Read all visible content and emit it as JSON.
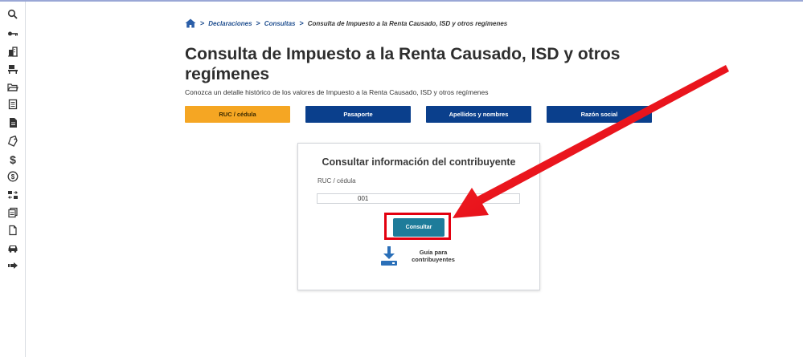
{
  "sidebar": {
    "icons": [
      "search-icon",
      "key-icon",
      "building-icon",
      "desk-icon",
      "folder-open-icon",
      "document-list-icon",
      "document-icon",
      "tag-icon",
      "dollar-icon",
      "dollar-circle-icon",
      "transfer-icon",
      "documents-stack-icon",
      "file-icon",
      "car-icon",
      "arrow-right-icon"
    ]
  },
  "breadcrumb": {
    "items": [
      "Declaraciones",
      "Consultas"
    ],
    "current": "Consulta de Impuesto a la Renta Causado, ISD y otros regímenes"
  },
  "page": {
    "title": "Consulta de Impuesto a la Renta Causado, ISD y otros regímenes",
    "description": "Conozca un detalle histórico de los valores de Impuesto a la Renta Causado, ISD y otros regímenes"
  },
  "tabs": [
    {
      "label": "RUC / cédula",
      "active": true
    },
    {
      "label": "Pasaporte",
      "active": false
    },
    {
      "label": "Apellidos y nombres",
      "active": false
    },
    {
      "label": "Razón social",
      "active": false
    }
  ],
  "card": {
    "title": "Consultar información del contribuyente",
    "field_label": "RUC / cédula",
    "field_value": "001",
    "button_label": "Consultar",
    "guide_label": "Guía para contribuyentes"
  },
  "colors": {
    "primary": "#0a3f8c",
    "active_tab": "#f5a623",
    "button": "#1e7c9a",
    "annotation": "#e3000f"
  }
}
